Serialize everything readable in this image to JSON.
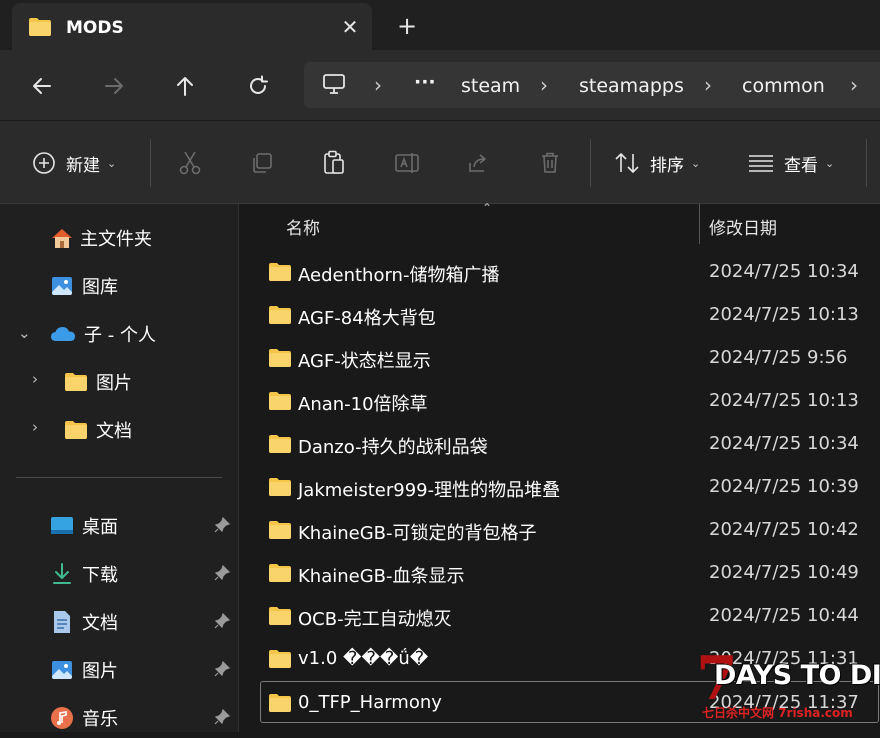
{
  "window": {
    "tab_title": "MODS",
    "close_glyph": "✕",
    "new_tab_glyph": "+"
  },
  "address_bar": {
    "more_glyph": "···",
    "breadcrumbs": [
      "steam",
      "steamapps",
      "common"
    ]
  },
  "toolbar": {
    "new_label": "新建",
    "sort_label": "排序",
    "view_label": "查看"
  },
  "sidebar": {
    "home_label": "主文件夹",
    "gallery_label": "图库",
    "onedrive_label": "子 - 个人",
    "onedrive_children": [
      "图片",
      "文档"
    ],
    "pinned": [
      "桌面",
      "下载",
      "文档",
      "图片",
      "音乐"
    ]
  },
  "columns": {
    "name": "名称",
    "modified": "修改日期"
  },
  "files": [
    {
      "name": "Aedenthorn-储物箱广播",
      "date": "2024/7/25 10:34"
    },
    {
      "name": "AGF-84格大背包",
      "date": "2024/7/25 10:13"
    },
    {
      "name": "AGF-状态栏显示",
      "date": "2024/7/25 9:56"
    },
    {
      "name": "Anan-10倍除草",
      "date": "2024/7/25 10:13"
    },
    {
      "name": "Danzo-持久的战利品袋",
      "date": "2024/7/25 10:34"
    },
    {
      "name": "Jakmeister999-理性的物品堆叠",
      "date": "2024/7/25 10:39"
    },
    {
      "name": "KhaineGB-可锁定的背包格子",
      "date": "2024/7/25 10:42"
    },
    {
      "name": "KhaineGB-血条显示",
      "date": "2024/7/25 10:49"
    },
    {
      "name": "OCB-完工自动熄灭",
      "date": "2024/7/25 10:44"
    },
    {
      "name": "v1.0 ���ǘ�",
      "date": "2024/7/25 11:31"
    },
    {
      "name": "0_TFP_Harmony",
      "date": "2024/7/25 11:37"
    }
  ],
  "watermark": {
    "logo_digit": "7",
    "logo_text": "DAYS TO DIE",
    "site_text": "七日杀中文网 7risha.com"
  },
  "colors": {
    "folder": "#f3c548",
    "accent": "#4cc2ff",
    "onedrive": "#3b9be8",
    "watermark_red": "#b01212"
  }
}
